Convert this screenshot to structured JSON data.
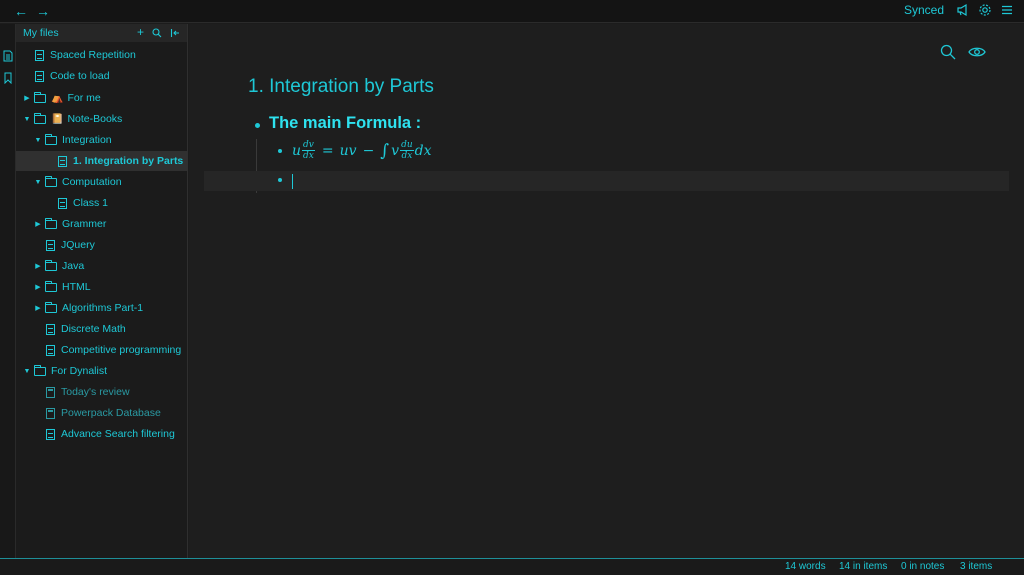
{
  "topbar": {
    "synced_label": "Synced",
    "icons": [
      "back-arrow-icon",
      "forward-arrow-icon",
      "megaphone-icon",
      "gear-icon",
      "menu-icon"
    ]
  },
  "sidebar": {
    "title": "My files",
    "tools": {
      "add": "+",
      "search": "search-icon",
      "collapse": "collapse-icon"
    },
    "items": [
      {
        "label": "Spaced Repetition",
        "type": "doc"
      },
      {
        "label": "Code to load",
        "type": "doc"
      },
      {
        "label": "For me",
        "type": "folder",
        "emoji": "⛺"
      },
      {
        "label": "Note-Books",
        "type": "folder",
        "emoji": "📔"
      },
      {
        "label": "Integration",
        "type": "folder"
      },
      {
        "label": "1. Integration by Parts",
        "type": "doc"
      },
      {
        "label": "Computation",
        "type": "folder"
      },
      {
        "label": "Class 1",
        "type": "doc"
      },
      {
        "label": "Grammer",
        "type": "folder"
      },
      {
        "label": "JQuery",
        "type": "doc"
      },
      {
        "label": "Java",
        "type": "folder"
      },
      {
        "label": "HTML",
        "type": "folder"
      },
      {
        "label": "Algorithms Part-1",
        "type": "folder"
      },
      {
        "label": "Discrete Math",
        "type": "doc"
      },
      {
        "label": "Competitive programming",
        "type": "doc"
      },
      {
        "label": "For Dynalist",
        "type": "folder"
      },
      {
        "label": "Today's review",
        "type": "box"
      },
      {
        "label": "Powerpack Database",
        "type": "box"
      },
      {
        "label": "Advance Search filtering",
        "type": "doc"
      }
    ]
  },
  "editor": {
    "title": "1. Integration by Parts",
    "heading": "The main Formula :",
    "formula": {
      "u": "u",
      "dv": "dv",
      "dx": "dx",
      "eq": "=",
      "uv": "uv",
      "minus": "−",
      "int": "∫",
      "v": "v",
      "du": "du",
      "dx_tail": "dx"
    }
  },
  "status": {
    "words": "14 words",
    "in_items": "14 in items",
    "in_notes": "0 in notes",
    "items": "3 items"
  },
  "colors": {
    "accent": "#1ec8d6",
    "background": "#1e1e1e",
    "sidebar": "#1b1b1b"
  }
}
